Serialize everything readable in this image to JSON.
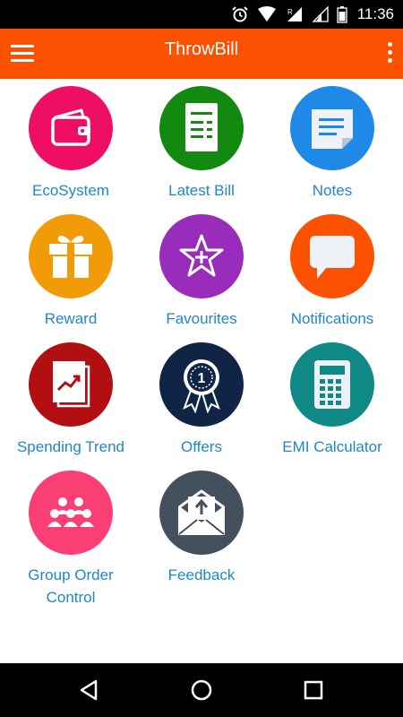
{
  "status_bar": {
    "time": "11:36"
  },
  "app_bar": {
    "title": "ThrowBill"
  },
  "tiles": [
    {
      "label": "EcoSystem",
      "color": "#ee0e63",
      "icon": "wallet-icon"
    },
    {
      "label": "Latest Bill",
      "color": "#128a0f",
      "icon": "bill-icon"
    },
    {
      "label": "Notes",
      "color": "#1e89e6",
      "icon": "note-icon"
    },
    {
      "label": "Reward",
      "color": "#f09b07",
      "icon": "gift-icon"
    },
    {
      "label": "Favourites",
      "color": "#9a2cbb",
      "icon": "star-icon"
    },
    {
      "label": "Notifications",
      "color": "#fb5100",
      "icon": "chat-bubble-icon"
    },
    {
      "label": "Spending Trend",
      "color": "#b20f12",
      "icon": "trend-chart-icon"
    },
    {
      "label": "Offers",
      "color": "#102446",
      "icon": "badge-ribbon-icon"
    },
    {
      "label": "EMI Calculator",
      "color": "#0f8a86",
      "icon": "calculator-icon"
    },
    {
      "label": "Group Order Control",
      "color": "#fa3f74",
      "icon": "group-people-icon"
    },
    {
      "label": "Feedback",
      "color": "#44505e",
      "icon": "envelope-upload-icon"
    }
  ],
  "nav_bar": {
    "back": "back-icon",
    "home": "home-icon",
    "recents": "recents-icon"
  }
}
